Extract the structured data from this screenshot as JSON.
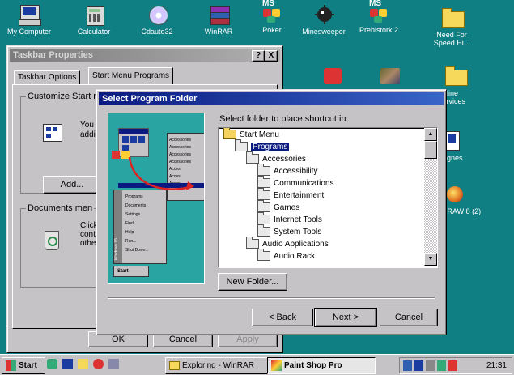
{
  "desktop": {
    "icons": [
      {
        "label": "My Computer"
      },
      {
        "label": "Calculator"
      },
      {
        "label": "Cdauto32"
      },
      {
        "label": "WinRAR"
      },
      {
        "label": "Poker"
      },
      {
        "label": "Minesweeper"
      },
      {
        "label": "Prehistork 2"
      },
      {
        "label": "Need For Speed Hi..."
      },
      {
        "label": "online services"
      },
      {
        "label": "Agnes"
      },
      {
        "label": "DRAW 8 (2)"
      }
    ]
  },
  "taskbar_props": {
    "title": "Taskbar Properties",
    "help_btn": "?",
    "close_btn": "X",
    "tabs": [
      "Taskbar Options",
      "Start Menu Programs"
    ],
    "customize_group": "Customize Start m",
    "customize_text": "You addi",
    "add_btn": "Add...",
    "documents_group": "Documents men",
    "documents_text": "Click cont othe",
    "ok_btn": "OK",
    "cancel_btn": "Cancel",
    "apply_btn": "Apply"
  },
  "dialog": {
    "title": "Select Program Folder",
    "prompt": "Select folder to place shortcut in:",
    "tree": [
      {
        "label": "Start Menu",
        "level": 0,
        "type": "folder"
      },
      {
        "label": "Programs",
        "level": 1,
        "type": "prog",
        "selected": true
      },
      {
        "label": "Accessories",
        "level": 2,
        "type": "prog"
      },
      {
        "label": "Accessibility",
        "level": 3,
        "type": "prog"
      },
      {
        "label": "Communications",
        "level": 3,
        "type": "prog"
      },
      {
        "label": "Entertainment",
        "level": 3,
        "type": "prog"
      },
      {
        "label": "Games",
        "level": 3,
        "type": "prog"
      },
      {
        "label": "Internet Tools",
        "level": 3,
        "type": "prog"
      },
      {
        "label": "System Tools",
        "level": 3,
        "type": "prog"
      },
      {
        "label": "Audio Applications",
        "level": 2,
        "type": "prog"
      },
      {
        "label": "Audio Rack",
        "level": 3,
        "type": "prog"
      }
    ],
    "new_folder_btn": "New Folder...",
    "back_btn": "< Back",
    "next_btn": "Next >",
    "cancel_btn": "Cancel"
  },
  "illustration": {
    "start_label": "Start",
    "menu_items": [
      "Programs",
      "Documents",
      "Settings",
      "Find",
      "Help",
      "Run...",
      "Shut Down..."
    ],
    "side_text": "Windows 95",
    "sub_items": [
      "Accessories",
      "Accessories",
      "Accessories",
      "Accessories",
      "Acces",
      "Acces",
      "Acces"
    ]
  },
  "taskbar": {
    "start_label": "Start",
    "buttons": [
      {
        "label": "Exploring - WinRAR",
        "active": false
      },
      {
        "label": "Paint Shop Pro",
        "active": true
      }
    ],
    "clock": "21:31"
  },
  "colors": {
    "desktop": "#0f7f83",
    "titlebar_active": "#0a1a80",
    "selection": "#0a1a80",
    "face": "#c6c3c6"
  }
}
